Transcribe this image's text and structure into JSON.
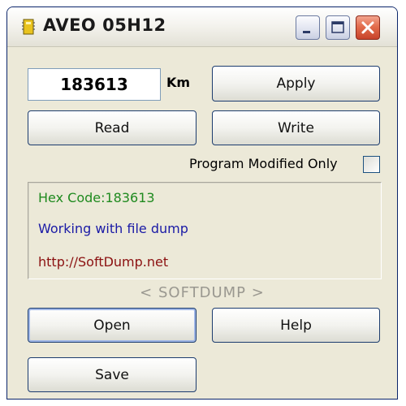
{
  "window": {
    "title": "AVEO 05H12",
    "icon": "chip-icon"
  },
  "odometer": {
    "value": "183613",
    "unit": "Km"
  },
  "buttons": {
    "apply": "Apply",
    "read": "Read",
    "write": "Write",
    "open": "Open",
    "help": "Help",
    "save": "Save"
  },
  "options": {
    "program_modified_only_label": "Program Modified Only",
    "program_modified_only_checked": false
  },
  "log": [
    {
      "text": "Hex Code:183613",
      "color": "#1f8a1f"
    },
    {
      "text": "Working with file dump",
      "color": "#1a1aa6"
    },
    {
      "text": "http://SoftDump.net",
      "color": "#8b1010"
    }
  ],
  "brand": "< SOFTDUMP >",
  "colors": {
    "window_bg": "#ece9d8",
    "button_border": "#1c3c6e",
    "close_button": "#e36d4d"
  }
}
